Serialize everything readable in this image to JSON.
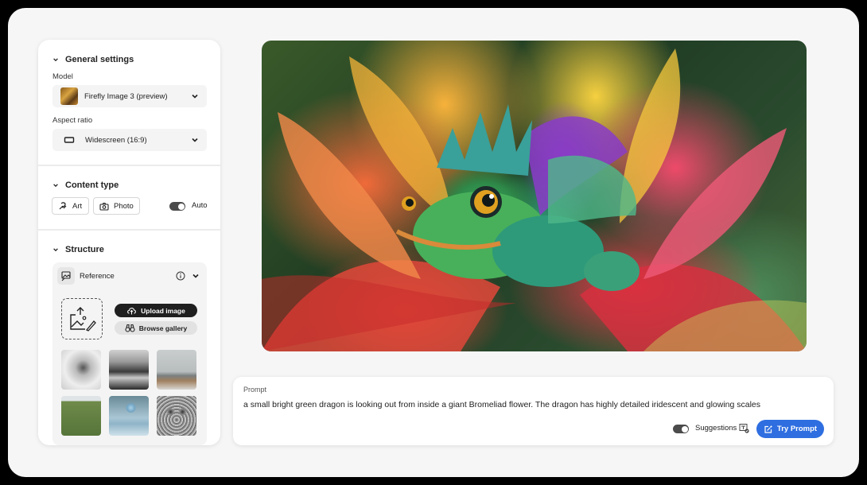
{
  "sidebar": {
    "general_settings": {
      "title": "General settings",
      "model_label": "Model",
      "model_value": "Firefly Image 3 (preview)",
      "aspect_label": "Aspect ratio",
      "aspect_value": "Widescreen (16:9)"
    },
    "content_type": {
      "title": "Content type",
      "art_label": "Art",
      "photo_label": "Photo",
      "auto_label": "Auto",
      "auto_enabled": true
    },
    "structure": {
      "title": "Structure",
      "reference_label": "Reference",
      "upload_label": "Upload image",
      "browse_label": "Browse gallery",
      "gallery": [
        {
          "name": "bird-sketch"
        },
        {
          "name": "misty-river"
        },
        {
          "name": "living-room"
        },
        {
          "name": "country-road"
        },
        {
          "name": "sphere-cube"
        },
        {
          "name": "owl-sketch"
        }
      ]
    }
  },
  "preview": {
    "alt": "small bright green dragon in a giant Bromeliad flower"
  },
  "prompt": {
    "label": "Prompt",
    "text": "a small bright green dragon is looking out from inside a giant Bromeliad flower. The dragon has highly detailed iridescent and glowing scales",
    "suggestions_label": "Suggestions",
    "suggestions_enabled": true,
    "try_label": "Try Prompt"
  },
  "colors": {
    "accent": "#2e6ee0",
    "dark_button": "#1f1f1f"
  }
}
